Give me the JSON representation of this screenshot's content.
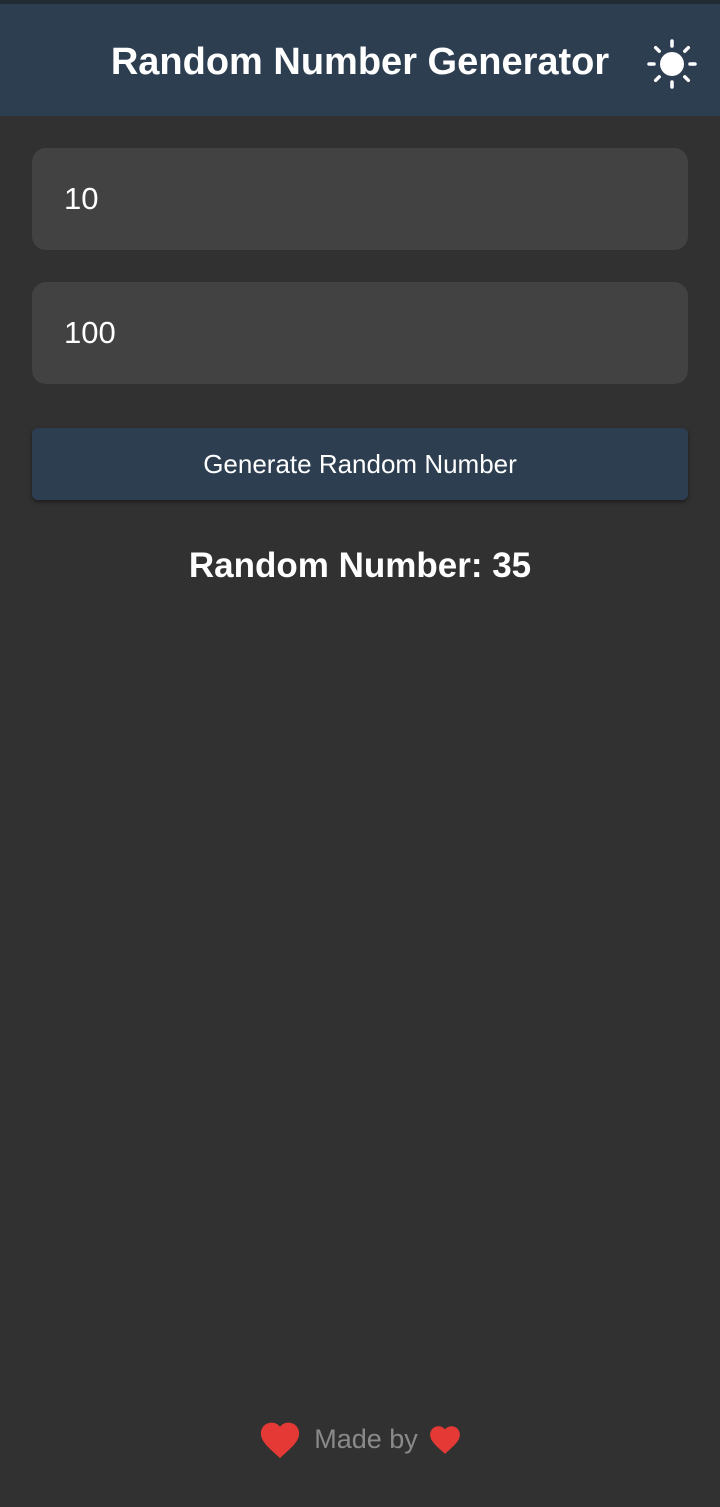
{
  "header": {
    "title": "Random Number Generator",
    "theme_icon": "sun-icon"
  },
  "form": {
    "min_value": "10",
    "max_value": "100",
    "generate_label": "Generate Random Number"
  },
  "result": {
    "text": "Random Number: 35"
  },
  "footer": {
    "text": "Made by",
    "heart_icon": "heart-icon"
  },
  "colors": {
    "background": "#313131",
    "header": "#2c3e50",
    "field": "#424242",
    "heart": "#e53935"
  }
}
